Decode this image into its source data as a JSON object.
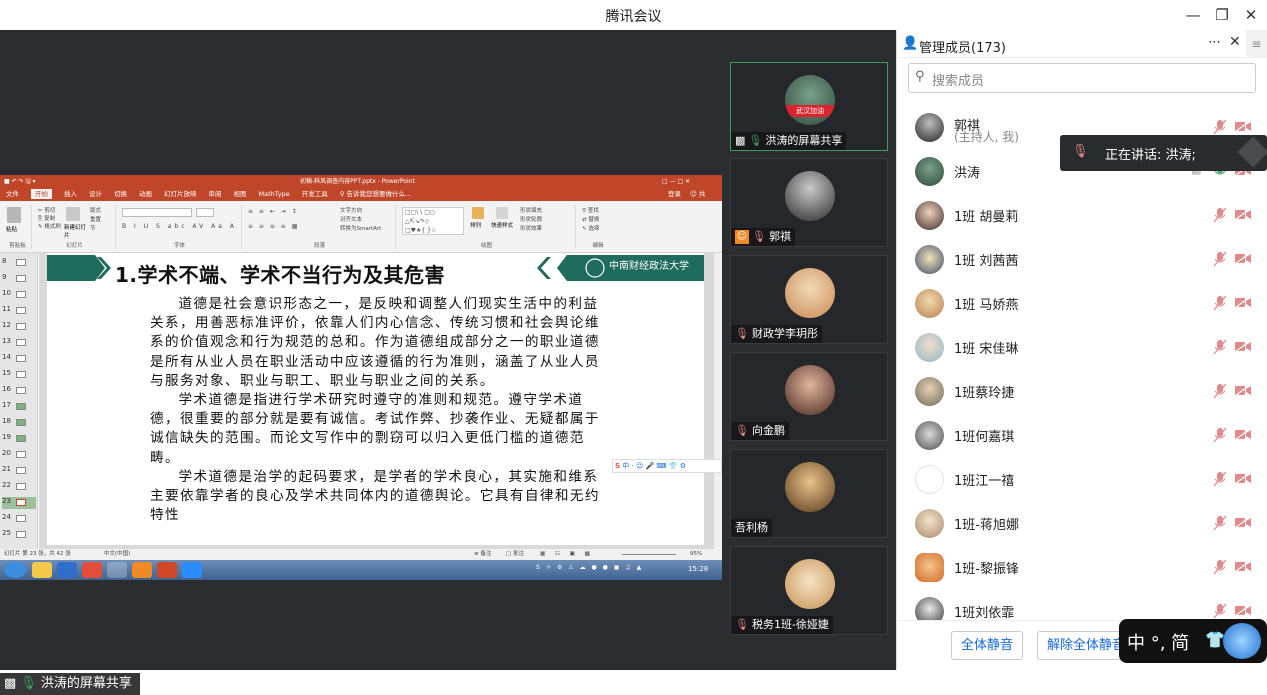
{
  "window": {
    "title": "腾讯会议"
  },
  "stage": {
    "label": "洪涛的屏幕共享"
  },
  "ppt": {
    "file_title": "初稿-科风调查内容PPT.pptx - PowerPoint",
    "tabs": [
      "文件",
      "开始",
      "插入",
      "设计",
      "切换",
      "动画",
      "幻灯片放映",
      "审阅",
      "视图",
      "MathType",
      "开发工具"
    ],
    "tell_me": "告诉我您想要做什么...",
    "login": "登录",
    "share": "共享",
    "ribbon_groups": [
      "剪贴板",
      "幻灯片",
      "字体",
      "段落",
      "绘图",
      "编辑"
    ],
    "ribbon_labels": {
      "paste": "粘贴",
      "new_slide": "新建幻灯片",
      "layout": "版式",
      "reset": "重置",
      "section": "节",
      "text_direction": "文字方向",
      "align_text": "对齐文本",
      "smartart": "转换为SmartArt",
      "arrange": "排列",
      "quick_styles": "快速样式",
      "shape_fill": "形状填充",
      "shape_outline": "形状轮廓",
      "shape_effects": "形状效果",
      "find": "查找",
      "replace": "替换",
      "select": "选择"
    },
    "thumb_numbers": [
      "8",
      "9",
      "10",
      "11",
      "12",
      "13",
      "14",
      "15",
      "16",
      "17",
      "18",
      "19",
      "20",
      "21",
      "22",
      "23",
      "24",
      "25"
    ],
    "status": "幻灯片 第 23 张，共 42 张",
    "language": "中文(中国)",
    "notes": "备注",
    "comments": "批注",
    "zoom": "95%",
    "clock": "15:28",
    "ime_bar": "中 · ☺ 🎤 ⌨ 👕 ⚙"
  },
  "slide": {
    "title": "1.学术不端、学术不当行为及其危害",
    "logo": "中南财经政法大学",
    "paragraphs": [
      "道德是社会意识形态之一，是反映和调整人们现实生活中的利益关系，用善恶标准评价，依靠人们内心信念、传统习惯和社会舆论维系的价值观念和行为规范的总和。作为道德组成部分之一的职业道德是所有从业人员在职业活动中应该遵循的行为准则，涵盖了从业人员与服务对象、职业与职工、职业与职业之间的关系。",
      "学术道德是指进行学术研究时遵守的准则和规范。遵守学术道德，很重要的部分就是要有诚信。考试作弊、抄袭作业、无疑都属于诚信缺失的范围。而论文写作中的剽窃可以归入更低门槛的道德范畴。",
      "学术道德是治学的起码要求，是学者的学术良心，其实施和维系主要依靠学者的良心及学术共同体内的道德舆论。它具有自律和无约特性"
    ]
  },
  "videos": [
    {
      "name": "洪涛的屏幕共享",
      "active": true,
      "avatar_text": "武汉加油"
    },
    {
      "name": "郭祺",
      "active": false
    },
    {
      "name": "财政学李玥彤",
      "active": false
    },
    {
      "name": "向金鹏",
      "active": false
    },
    {
      "name": "吾利杨",
      "active": false
    },
    {
      "name": "税务1班-徐娅婕",
      "active": false
    }
  ],
  "members": {
    "title": "管理成员(173)",
    "search_placeholder": "搜索成员",
    "speaking": "正在讲话: 洪涛;",
    "list": [
      {
        "name": "郭祺",
        "sub": "(主持人, 我)"
      },
      {
        "name": "洪涛",
        "sub": ""
      },
      {
        "name": "1班 胡曼莉",
        "sub": ""
      },
      {
        "name": "1班 刘茜茜",
        "sub": ""
      },
      {
        "name": "1班 马娇燕",
        "sub": ""
      },
      {
        "name": "1班 宋佳琳",
        "sub": ""
      },
      {
        "name": "1班蔡玲捷",
        "sub": ""
      },
      {
        "name": "1班何嘉琪",
        "sub": ""
      },
      {
        "name": "1班江一禧",
        "sub": ""
      },
      {
        "name": "1班-蒋旭娜",
        "sub": ""
      },
      {
        "name": "1班-黎振锋",
        "sub": ""
      },
      {
        "name": "1班刘依霏",
        "sub": ""
      }
    ],
    "mute_all": "全体静音",
    "unmute_all": "解除全体静音"
  },
  "ime_float": {
    "text": "中 °, 简"
  },
  "colors": {
    "accent_red": "#c0462a",
    "dark_bg": "#2c2d30",
    "link_blue": "#1769d8",
    "muted_red": "#e08a8a",
    "active_green": "#3aa15d"
  }
}
